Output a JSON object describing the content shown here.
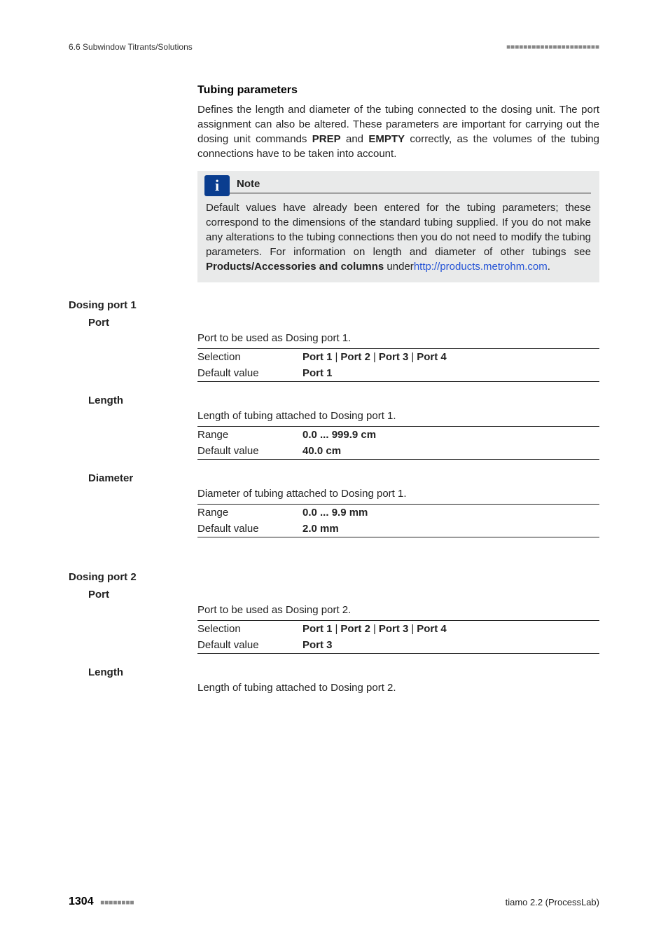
{
  "header": {
    "left": "6.6 Subwindow Titrants/Solutions",
    "squares": "■■■■■■■■■■■■■■■■■■■■■■"
  },
  "tubing": {
    "heading": "Tubing parameters",
    "intro_a": "Defines the length and diameter of the tubing connected to the dosing unit. The port assignment can also be altered. These parameters are important for carrying out the dosing unit commands ",
    "intro_prep": "PREP",
    "intro_mid": " and ",
    "intro_empty": "EMPTY",
    "intro_b": " correctly, as the volumes of the tubing connections have to be taken into account."
  },
  "note": {
    "title": "Note",
    "body_a": "Default values have already been entered for the tubing parameters; these correspond to the dimensions of the standard tubing supplied. If you do not make any alterations to the tubing connections then you do not need to modify the tubing parameters. For information on length and diameter of other tubings see ",
    "body_strong": "Products/Accessories and columns",
    "body_under": " under",
    "link_a": "http://products.metrohm.com",
    "body_end": "."
  },
  "labels": {
    "selection": "Selection",
    "default_value": "Default value",
    "range": "Range"
  },
  "dp1": {
    "title": "Dosing port 1",
    "port": {
      "label": "Port",
      "desc": "Port to be used as Dosing port 1.",
      "option1": "Port 1",
      "option2": "Port 2",
      "option3": "Port 3",
      "option4": "Port 4",
      "default": "Port 1"
    },
    "length": {
      "label": "Length",
      "desc": "Length of tubing attached to Dosing port 1.",
      "range": "0.0 ... 999.9 cm",
      "default": "40.0 cm"
    },
    "diameter": {
      "label": "Diameter",
      "desc": "Diameter of tubing attached to Dosing port 1.",
      "range": "0.0 ... 9.9 mm",
      "default": "2.0 mm"
    }
  },
  "dp2": {
    "title": "Dosing port 2",
    "port": {
      "label": "Port",
      "desc": "Port to be used as Dosing port 2.",
      "option1": "Port 1",
      "option2": "Port 2",
      "option3": "Port 3",
      "option4": "Port 4",
      "default": "Port 3"
    },
    "length": {
      "label": "Length",
      "desc": "Length of tubing attached to Dosing port 2."
    }
  },
  "footer": {
    "page": "1304",
    "squares": "■■■■■■■■",
    "product": "tiamo 2.2 (ProcessLab)"
  }
}
